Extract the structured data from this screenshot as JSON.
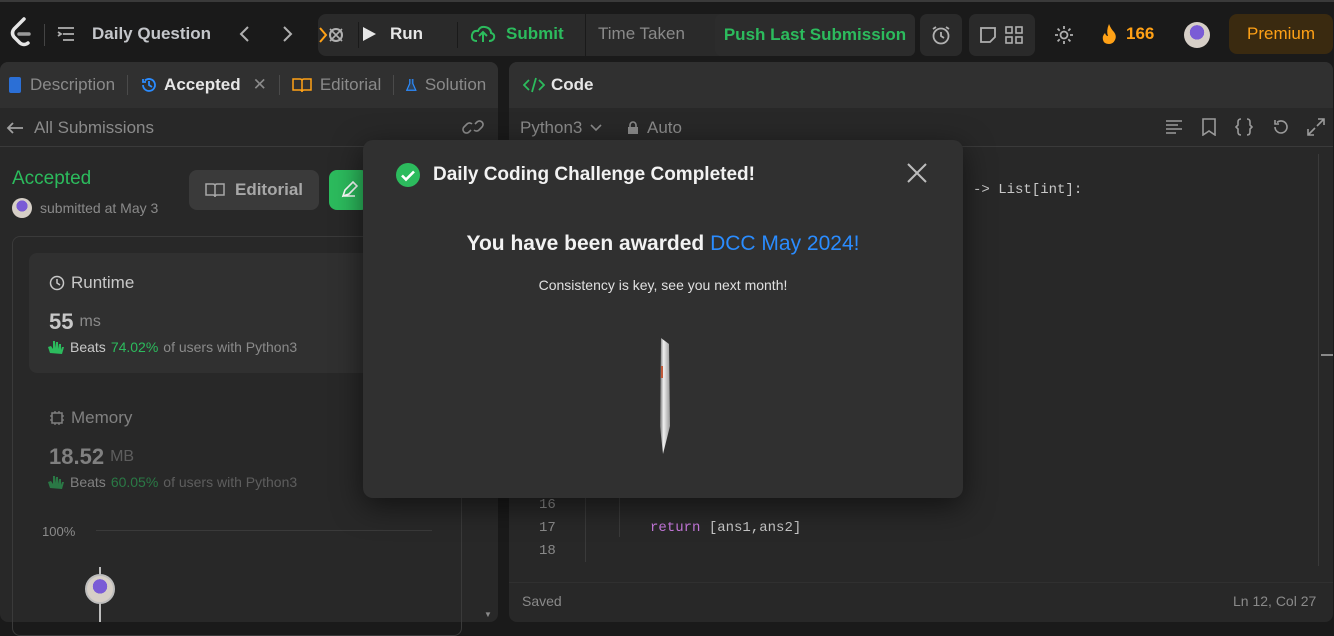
{
  "topbar": {
    "daily_question": "Daily Question",
    "run": "Run",
    "submit": "Submit",
    "time_taken": "Time Taken",
    "push_last_submission": "Push Last Submission",
    "streak_count": "166",
    "premium": "Premium"
  },
  "left_panel": {
    "tabs": [
      {
        "label": "Description"
      },
      {
        "label": "Accepted"
      },
      {
        "label": "Editorial"
      },
      {
        "label": "Solution"
      }
    ],
    "all_submissions": "All Submissions",
    "status": "Accepted",
    "submitted_text": "submitted at May 3",
    "editorial_button": "Editorial",
    "runtime": {
      "label": "Runtime",
      "value": "55",
      "unit": "ms",
      "beats_label": "Beats",
      "beats_value": "74.02%",
      "beats_suffix": "of users with Python3"
    },
    "memory": {
      "label": "Memory",
      "value": "18.52",
      "unit": "MB",
      "beats_label": "Beats",
      "beats_value": "60.05%",
      "beats_suffix": "of users with Python3"
    },
    "chart_label": "100%"
  },
  "right_panel": {
    "tab": "Code",
    "language": "Python3",
    "mode": "Auto",
    "code_lines": [
      {
        "num": "",
        "text": "-> List[int]:"
      },
      {
        "num": "16",
        "text": ""
      },
      {
        "num": "17",
        "text": "return [ans1,ans2]"
      },
      {
        "num": "18",
        "text": ""
      }
    ],
    "status": "Saved",
    "cursor": "Ln 12, Col 27"
  },
  "modal": {
    "title": "Daily Coding Challenge Completed!",
    "award_prefix": "You have been awarded ",
    "award_name": "DCC May 2024!",
    "subtitle": "Consistency is key, see you next month!"
  },
  "colors": {
    "accent_green": "#2cbb5d",
    "accent_orange": "#ffa116",
    "award_blue": "#2a8cff"
  }
}
